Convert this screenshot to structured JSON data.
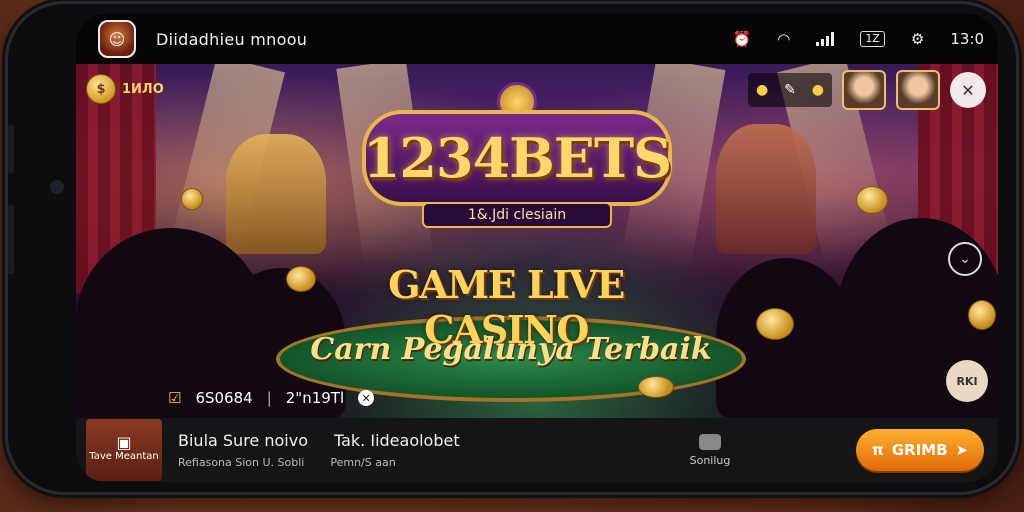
{
  "status_bar": {
    "app_icon": "casino-app-icon",
    "title": "Diidadhieu mnoou",
    "icons": [
      "alarm-icon",
      "wifi-icon",
      "signal-icon"
    ],
    "battery": "1Z",
    "time": "13:0"
  },
  "game": {
    "coin_balance": "1ИЛО",
    "brand_logo": "1234BETS",
    "brand_subtitle": "1&.Jdi clesiain",
    "headline": "GAME LIVE CASINO",
    "subheadline": "Carn Pegalunya Terbaik",
    "info": {
      "stat1": "6S0684",
      "separator": "|",
      "stat2": "2\"n19Tl"
    },
    "right_bottom_button": "RKI",
    "top_right_tools": [
      "coin-icon",
      "pen-icon",
      "coin-icon"
    ]
  },
  "bottom_bar": {
    "menu_tile_label": "Tave Meantan",
    "line1": [
      "Biula Sure noivo",
      "Tak. Iideaolobet"
    ],
    "line2": [
      "Refiasona Sion U. Sobli",
      "Pemn/S aan"
    ],
    "center_label": "Sonilug",
    "cta_label": "GRIMB",
    "cta_prefix": "π"
  }
}
